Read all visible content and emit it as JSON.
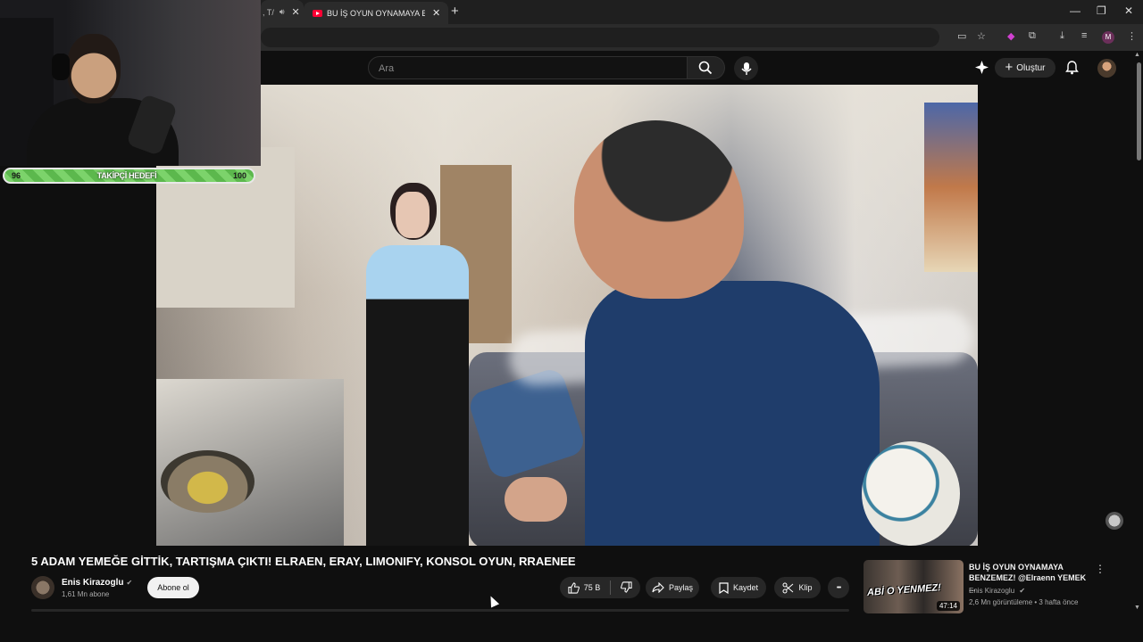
{
  "browser": {
    "tabs": [
      {
        "label": ", T/"
      },
      {
        "label": "BU İŞ OYUN OYNAMAYA BENZEMEZ!"
      }
    ],
    "new_tab": "+",
    "close_glyph": "✕",
    "window_controls": {
      "minimize": "—",
      "restore": "❐",
      "close": "✕"
    },
    "profile_initial": "M"
  },
  "youtube_header": {
    "search_placeholder": "Ara",
    "create_label": "Oluştur"
  },
  "overlay": {
    "goal_current": "96",
    "goal_label": "TAKİPÇİ HEDEFİ",
    "goal_target": "100",
    "goal_progress": 0.96
  },
  "video": {
    "title": "5 ADAM YEMEĞE GİTTİK, TARTIŞMA ÇIKTI! ELRAEN, ERAY, LIMONIFY, KONSOL OYUN, RRAENEE",
    "channel": {
      "name": "Enis Kirazoglu",
      "subscribers": "1,61 Mn abone",
      "verified": "✔"
    },
    "subscribe_label": "Abone ol",
    "actions": {
      "likes": "75 B",
      "share": "Paylaş",
      "save": "Kaydet",
      "clip": "Klip",
      "more": "•••"
    }
  },
  "suggestion": {
    "thumb_text": "ABİ O YENMEZ!",
    "duration": "47:14",
    "title": "BU İŞ OYUN OYNAMAYA BENZEMEZ! @Elraenn YEMEK ...",
    "channel": "Enis Kirazoglu",
    "meta": "2,6 Mn görüntüleme • 3 hafta önce"
  },
  "colors": {
    "youtube_red": "#ff0033",
    "goal_green": "#7cd36b",
    "background": "#0f0f0f"
  }
}
